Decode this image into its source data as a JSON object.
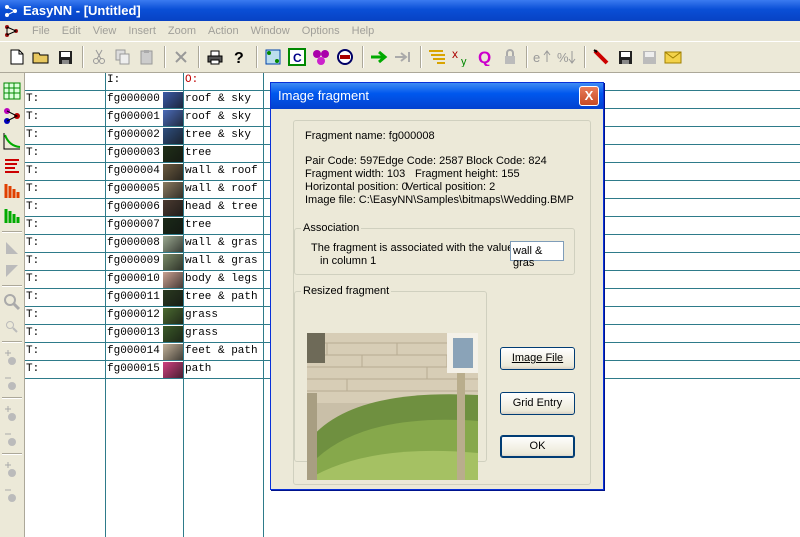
{
  "window": {
    "title": "EasyNN - [Untitled]"
  },
  "menu": [
    "File",
    "Edit",
    "View",
    "Insert",
    "Zoom",
    "Action",
    "Window",
    "Options",
    "Help"
  ],
  "toolbar": [
    "new-icon",
    "open-icon",
    "save-icon",
    "cut-icon",
    "copy-icon",
    "paste-icon",
    "delete-icon",
    "print-icon",
    "help-icon",
    "grid-fit-icon",
    "calculate-icon",
    "network-icon",
    "stop-icon",
    "learn-icon",
    "step-icon",
    "query-pattern-icon",
    "xy-icon",
    "query-icon",
    "lock-icon",
    "error-up-icon",
    "error-down-icon",
    "pen-icon",
    "save-network-icon",
    "disk-icon",
    "mail-icon"
  ],
  "grid": {
    "headers": {
      "input": "I:",
      "output": "O:"
    },
    "rows": [
      {
        "type": "T:",
        "name": "fg000000",
        "label": "roof & sky"
      },
      {
        "type": "T:",
        "name": "fg000001",
        "label": "roof & sky"
      },
      {
        "type": "T:",
        "name": "fg000002",
        "label": "tree & sky"
      },
      {
        "type": "T:",
        "name": "fg000003",
        "label": "tree"
      },
      {
        "type": "T:",
        "name": "fg000004",
        "label": "wall & roof"
      },
      {
        "type": "T:",
        "name": "fg000005",
        "label": "wall & roof"
      },
      {
        "type": "T:",
        "name": "fg000006",
        "label": "head & tree"
      },
      {
        "type": "T:",
        "name": "fg000007",
        "label": "tree"
      },
      {
        "type": "T:",
        "name": "fg000008",
        "label": "wall & gras"
      },
      {
        "type": "T:",
        "name": "fg000009",
        "label": "wall & gras"
      },
      {
        "type": "T:",
        "name": "fg000010",
        "label": "body & legs"
      },
      {
        "type": "T:",
        "name": "fg000011",
        "label": "tree & path"
      },
      {
        "type": "T:",
        "name": "fg000012",
        "label": "grass"
      },
      {
        "type": "T:",
        "name": "fg000013",
        "label": "grass"
      },
      {
        "type": "T:",
        "name": "fg000014",
        "label": "feet & path"
      },
      {
        "type": "T:",
        "name": "fg000015",
        "label": "path"
      }
    ],
    "thumb_colors": [
      "#3a5aa8",
      "#4a6bb8",
      "#2f4f7f",
      "#203018",
      "#6a5a40",
      "#8a7a60",
      "#4a3a30",
      "#1a2a18",
      "#9aa890",
      "#7a8a68",
      "#c8a090",
      "#2a3a20",
      "#4a6a30",
      "#3a5a28",
      "#c0b098",
      "#d04080"
    ]
  },
  "dialog": {
    "title": "Image fragment",
    "close": "X",
    "fragment_name": "Fragment name: fg000008",
    "pair_code": "Pair Code: 597",
    "edge_code": "Edge Code: 2587",
    "block_code": "Block Code: 824",
    "fragment_width": "Fragment width: 103",
    "fragment_height": "Fragment height: 155",
    "horizontal_position": "Horizontal position: 0",
    "vertical_position": "Vertical position: 2",
    "image_file": "Image file:  C:\\EasyNN\\Samples\\bitmaps\\Wedding.BMP",
    "association": {
      "group_label": "Association",
      "line1": "The fragment is associated with the value",
      "line2": "in column 1",
      "value": "wall & gras"
    },
    "resized_fragment_label": "Resized fragment",
    "buttons": {
      "image_file": "Image File",
      "grid_entry": "Grid Entry",
      "ok": "OK"
    }
  }
}
